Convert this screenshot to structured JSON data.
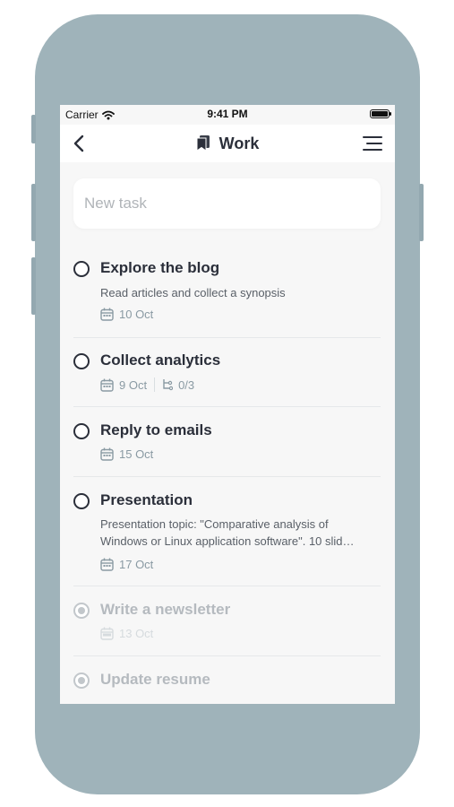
{
  "status_bar": {
    "carrier": "Carrier",
    "time": "9:41 PM"
  },
  "header": {
    "title": "Work"
  },
  "new_task": {
    "placeholder": "New task"
  },
  "tasks": [
    {
      "name": "Explore the blog",
      "description": "Read articles and collect a synopsis",
      "date": "10 Oct",
      "completed": false
    },
    {
      "name": "Collect analytics",
      "date": "9 Oct",
      "subtasks": "0/3",
      "completed": false
    },
    {
      "name": "Reply to emails",
      "date": "15 Oct",
      "completed": false
    },
    {
      "name": "Presentation",
      "description_line1": "Presentation topic: \"Comparative analysis of",
      "description_line2": "Windows or Linux application software\". 10 slid…",
      "date": "17 Oct",
      "completed": false
    },
    {
      "name": "Write a newsletter",
      "date": "13 Oct",
      "completed": true
    },
    {
      "name": "Update resume",
      "completed": true
    }
  ],
  "colors": {
    "phone_frame": "#9fb3ba",
    "text_primary": "#2b2f3a",
    "meta": "#8a9aa3",
    "background": "#f7f7f7"
  }
}
